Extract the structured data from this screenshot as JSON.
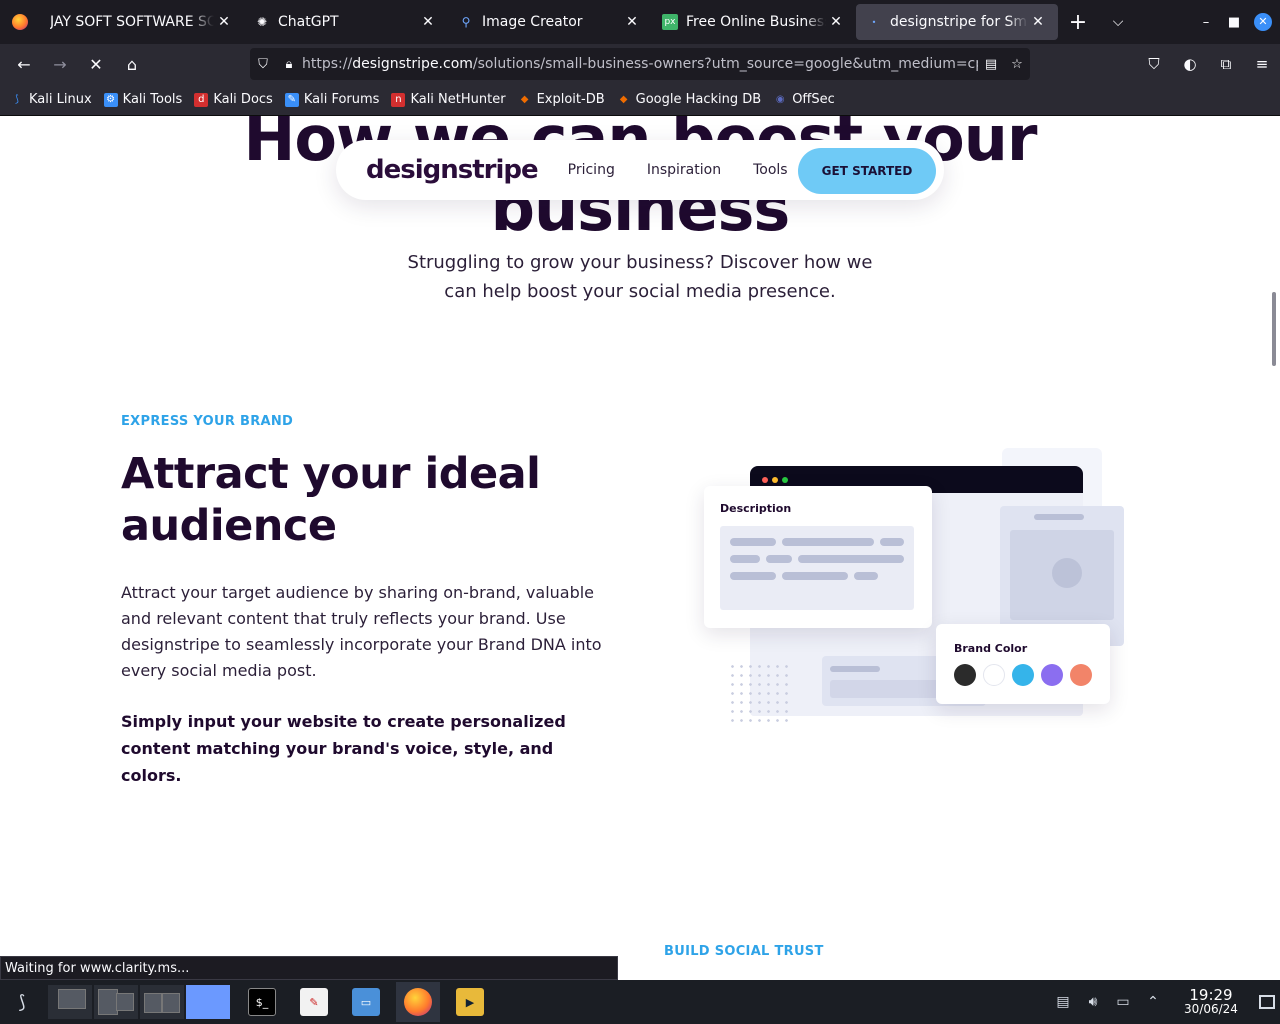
{
  "browser": {
    "tabs": [
      {
        "label": "JAY SOFT SOFTWARE SOLUTIONS",
        "icon": "firefox-icon"
      },
      {
        "label": "ChatGPT",
        "icon": "chatgpt-icon"
      },
      {
        "label": "Image Creator",
        "icon": "search-icon"
      },
      {
        "label": "Free Online Business Ve",
        "icon": "pixlr-icon"
      },
      {
        "label": "designstripe for Small B",
        "icon": "loading-icon",
        "active": true
      }
    ],
    "url_domain": "designstripe.com",
    "url_prefix": "https://",
    "url_rest": "/solutions/small-business-owners?utm_source=google&utm_medium=cpc&u",
    "bookmarks": [
      {
        "label": "Kali Linux",
        "color": "#3a8ff8"
      },
      {
        "label": "Kali Tools",
        "color": "#3a8ff8"
      },
      {
        "label": "Kali Docs",
        "color": "#d32f2f"
      },
      {
        "label": "Kali Forums",
        "color": "#3a8ff8"
      },
      {
        "label": "Kali NetHunter",
        "color": "#d32f2f"
      },
      {
        "label": "Exploit-DB",
        "color": "#ef6c00"
      },
      {
        "label": "Google Hacking DB",
        "color": "#ef6c00"
      },
      {
        "label": "OffSec",
        "color": "#5c6bc0"
      }
    ],
    "status": "Waiting for www.clarity.ms..."
  },
  "site": {
    "logo": "designstripe",
    "nav": [
      "Pricing",
      "Inspiration",
      "Tools"
    ],
    "cta": "GET STARTED",
    "hero_title_line1": "How we can boost your",
    "hero_title_line2": "business",
    "hero_sub": "Struggling to grow your business? Discover how we can help boost your social media presence.",
    "section": {
      "eyebrow": "EXPRESS YOUR BRAND",
      "title": "Attract your ideal audience",
      "body": "Attract your target audience by sharing on-brand, valuable and relevant content that truly reflects your brand. Use designstripe to seamlessly incorporate your Brand DNA into every social media post.",
      "bold": "Simply input your website to create personalized content matching your brand's voice, style, and colors."
    },
    "illustration": {
      "description_label": "Description",
      "brand_color_label": "Brand Color",
      "brand_colors": [
        "#2b2b2b",
        "#ffffff",
        "#35b4ea",
        "#8b6ef0",
        "#f28469"
      ]
    },
    "next_eyebrow": "BUILD SOCIAL TRUST"
  },
  "taskbar": {
    "time": "19:29",
    "date": "30/06/24"
  }
}
